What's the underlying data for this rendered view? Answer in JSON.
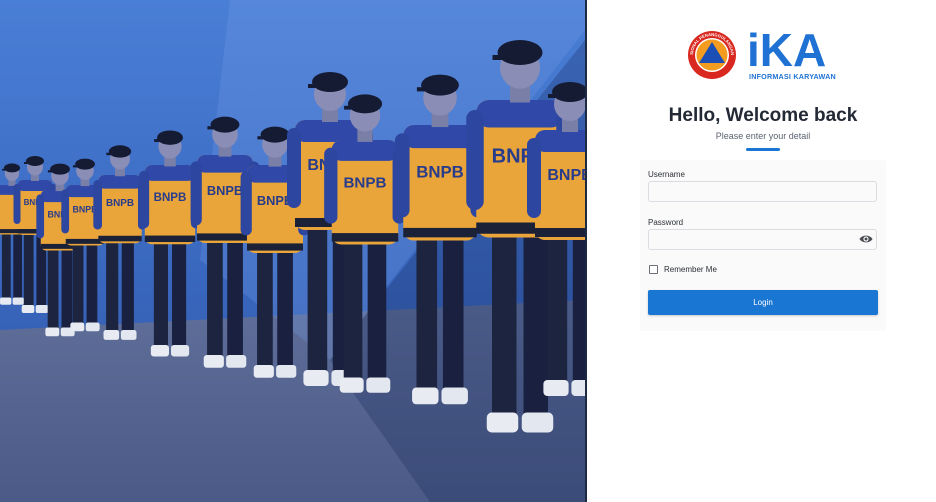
{
  "hero": {
    "uniform_text": "BNPB"
  },
  "brand": {
    "seal_text": "BADAN NASIONAL PENANGGULANGAN BENCANA",
    "logo_word": "iKA",
    "logo_subtitle": "INFORMASI KARYAWAN",
    "primary_color": "#1976d2",
    "seal_ring_color": "#d9281f",
    "seal_triangle_color": "#1b4fb5",
    "seal_disc_color": "#f39c1f"
  },
  "login": {
    "title": "Hello, Welcome back",
    "subtitle": "Please enter your detail",
    "username_label": "Username",
    "username_value": "",
    "password_label": "Password",
    "password_value": "",
    "remember_label": "Remember Me",
    "remember_checked": false,
    "submit_label": "Login"
  }
}
